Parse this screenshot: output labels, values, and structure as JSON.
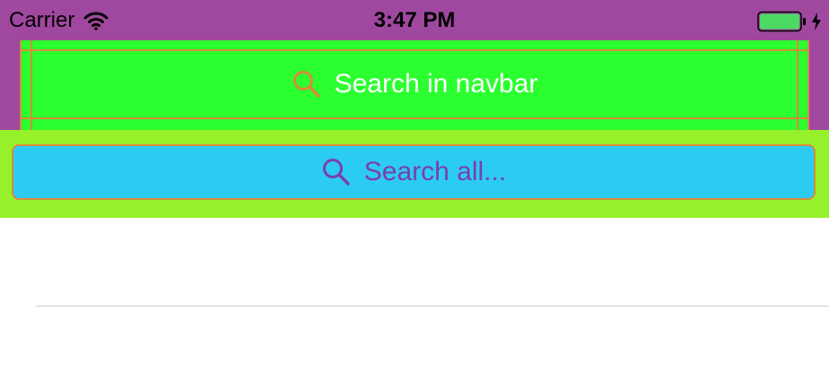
{
  "status_bar": {
    "carrier": "Carrier",
    "time": "3:47 PM",
    "icons": [
      "wifi-icon",
      "battery-icon",
      "charging-bolt-icon"
    ],
    "battery_level": 1.0,
    "battery_color": "#4cd964"
  },
  "navbar": {
    "search_placeholder": "Search in navbar",
    "icon": "search-icon",
    "background": "#2bff2f",
    "accent": "#d88a3c"
  },
  "search_bar": {
    "placeholder": "Search all...",
    "icon": "search-icon",
    "field_background": "#2ccbf4",
    "container_background": "#97f12a",
    "text_color": "#7b3fa8"
  },
  "theme": {
    "status_background": "#a0489f",
    "content_background": "#ffffff"
  }
}
